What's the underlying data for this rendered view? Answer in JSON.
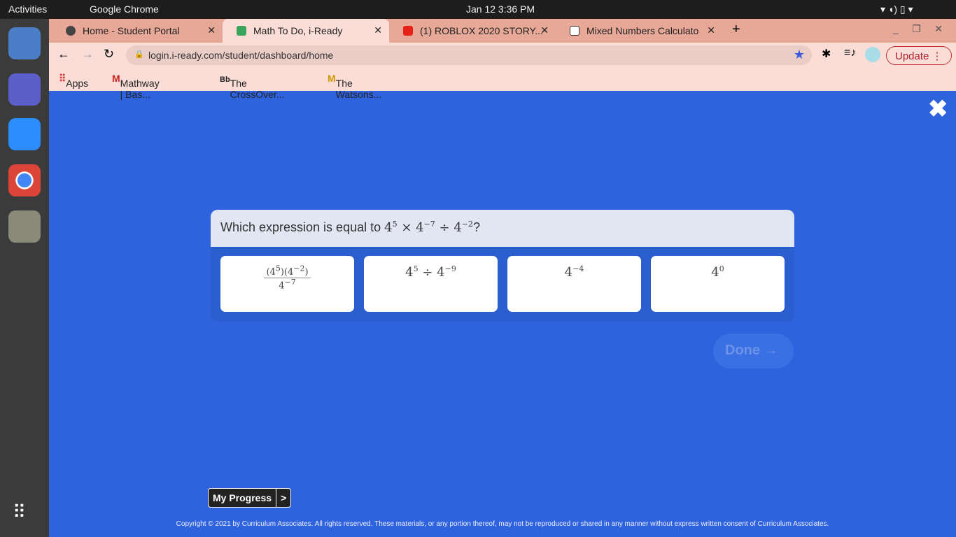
{
  "system": {
    "activities": "Activities",
    "app": "Google Chrome",
    "datetime": "Jan 12  3:36 PM"
  },
  "tabs": [
    {
      "label": "Home - Student Portal",
      "color": "#444"
    },
    {
      "label": "Math To Do, i-Ready",
      "color": "#3ba55d"
    },
    {
      "label": "(1) ROBLOX 2020 STORY...",
      "color": "#e62117"
    },
    {
      "label": "Mixed Numbers Calculato",
      "color": "#333"
    }
  ],
  "toolbar": {
    "url": "login.i-ready.com/student/dashboard/home",
    "update": "Update"
  },
  "bookmarks": [
    {
      "label": "Apps"
    },
    {
      "label": "Mathway | Bas..."
    },
    {
      "label": "The CrossOver..."
    },
    {
      "label": "The Watsons..."
    }
  ],
  "question": {
    "prefix": "Which expression is equal to",
    "suffix": "?"
  },
  "choices": [
    "(4^5)(4^-2) / 4^-7",
    "4^5 ÷ 4^-9",
    "4^-4",
    "4^0"
  ],
  "done": "Done →",
  "progress": {
    "label": "My Progress",
    "arrow": ">"
  },
  "copyright": "Copyright © 2021 by Curriculum Associates. All rights reserved. These materials, or any portion thereof, may not be reproduced or shared in any manner without express written consent of Curriculum Associates."
}
